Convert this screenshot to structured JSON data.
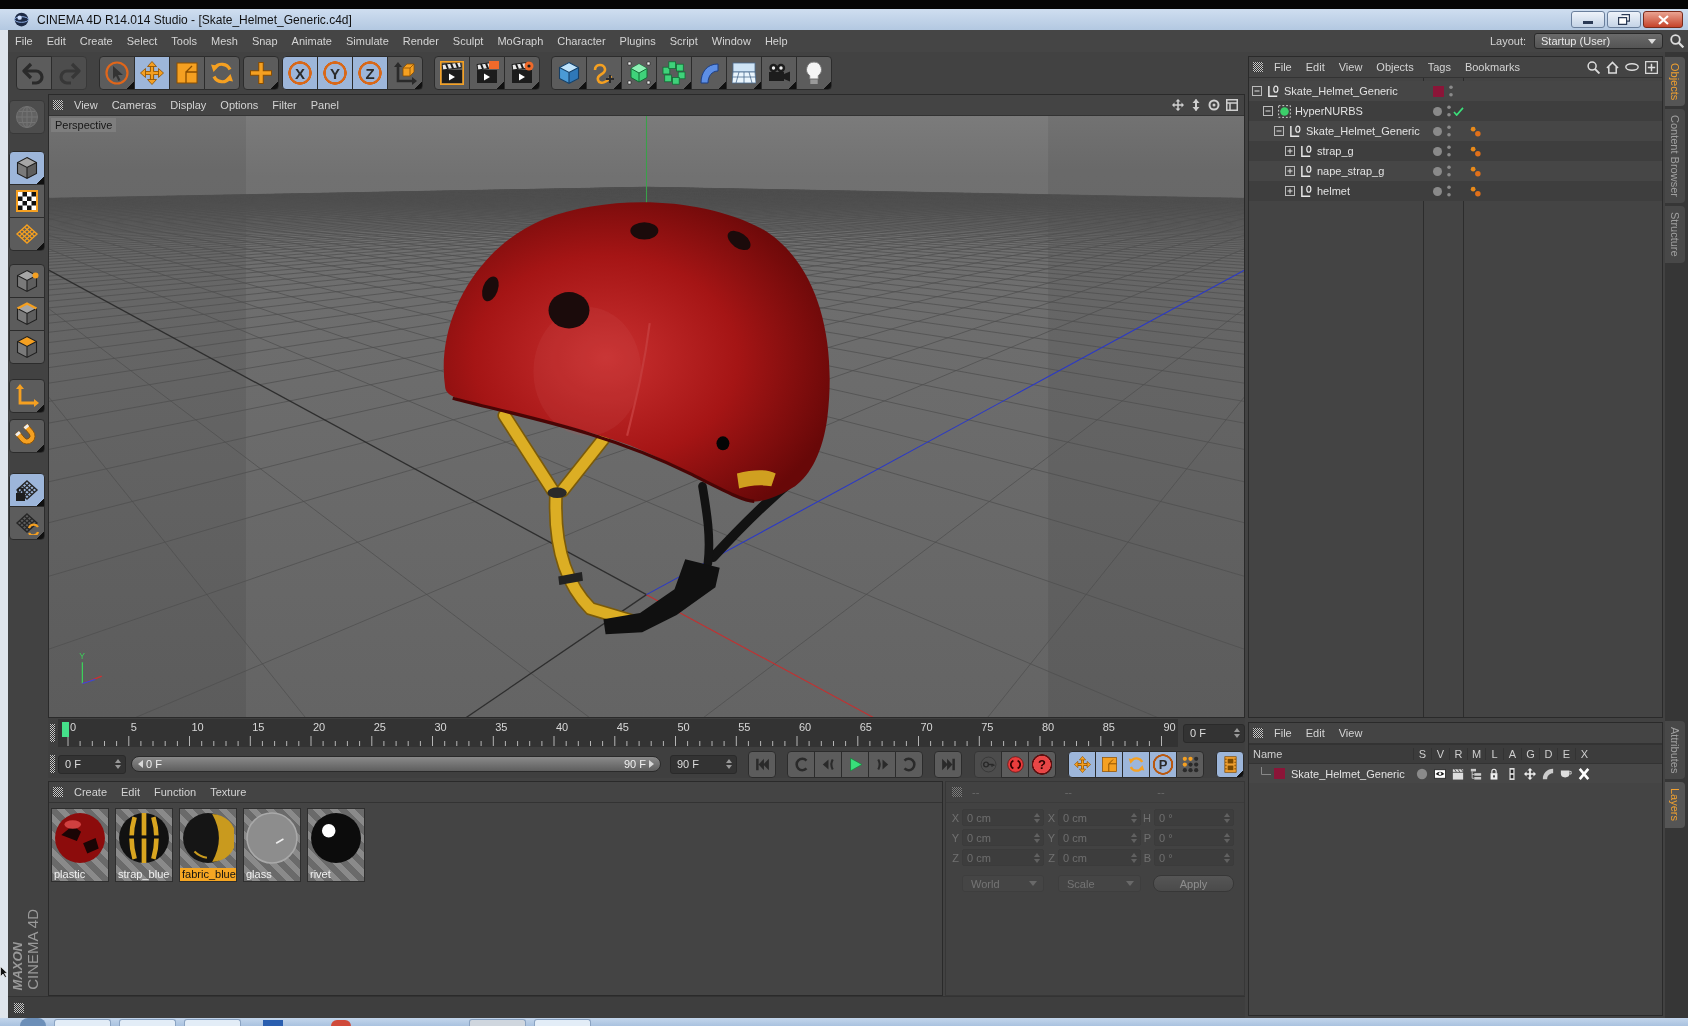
{
  "window": {
    "title": "CINEMA 4D R14.014 Studio - [Skate_Helmet_Generic.c4d]"
  },
  "menu": [
    "File",
    "Edit",
    "Create",
    "Select",
    "Tools",
    "Mesh",
    "Snap",
    "Animate",
    "Simulate",
    "Render",
    "Sculpt",
    "MoGraph",
    "Character",
    "Plugins",
    "Script",
    "Window",
    "Help"
  ],
  "layout": {
    "label": "Layout:",
    "value": "Startup (User)"
  },
  "toolbar": [
    [
      {
        "selected": false,
        "disabled": false
      },
      {
        "selected": false,
        "disabled": true
      }
    ],
    [
      {
        "selected": false
      },
      {
        "selected": true
      },
      {
        "selected": false
      },
      {
        "selected": false
      }
    ],
    [
      {
        "selected": false
      }
    ],
    [
      {
        "label": "X",
        "selected": true
      },
      {
        "label": "Y",
        "selected": true
      },
      {
        "label": "Z",
        "selected": true
      },
      {
        "selected": false
      }
    ],
    [
      {
        "selected": false
      },
      {
        "selected": false
      },
      {
        "selected": false
      }
    ],
    [
      {
        "selected": false
      },
      {
        "selected": false
      },
      {
        "selected": false
      },
      {
        "selected": false
      },
      {
        "selected": false
      },
      {
        "selected": false
      },
      {
        "selected": false
      },
      {
        "selected": false
      }
    ]
  ],
  "side_toolbar": [
    [
      {
        "selected": false,
        "disabled": true
      }
    ],
    [
      {
        "selected": true
      },
      {
        "selected": false
      },
      {
        "selected": false
      }
    ],
    [
      {
        "selected": false
      },
      {
        "selected": false
      },
      {
        "selected": false
      }
    ],
    [
      {
        "selected": false
      }
    ],
    [
      {
        "selected": false
      }
    ],
    [
      {
        "selected": true
      },
      {
        "selected": false
      }
    ]
  ],
  "logo": [
    "MAXON",
    "CINEMA 4D"
  ],
  "viewport": {
    "menu": [
      "View",
      "Cameras",
      "Display",
      "Options",
      "Filter",
      "Panel"
    ],
    "label": "Perspective",
    "axis_label": "Y"
  },
  "timeline": {
    "ticks": [
      "0",
      "5",
      "10",
      "15",
      "20",
      "25",
      "30",
      "35",
      "40",
      "45",
      "50",
      "55",
      "60",
      "65",
      "70",
      "75",
      "80",
      "85",
      "90"
    ],
    "level": 0,
    "frame": "0 F",
    "start": "0 F",
    "range_start": "0 F",
    "range_end": "90 F",
    "end": "90 F",
    "keys": [
      {
        "disabled": true
      },
      {
        "disabled": false
      },
      {
        "label": "?",
        "disabled": false
      }
    ],
    "modes": [
      {
        "selected": true
      },
      {
        "selected": true
      },
      {
        "selected": true
      },
      {
        "label": "P",
        "selected": true
      },
      {
        "selected": false
      }
    ],
    "timeline_button": {
      "selected": true
    }
  },
  "materials": {
    "menu": [
      "Create",
      "Edit",
      "Function",
      "Texture"
    ],
    "items": [
      {
        "name": "plastic",
        "selected": false
      },
      {
        "name": "strap_blue",
        "selected": false
      },
      {
        "name": "fabric_blue",
        "selected": true
      },
      {
        "name": "glass",
        "selected": false
      },
      {
        "name": "rivet",
        "selected": false
      }
    ]
  },
  "coordinates": {
    "disabled": true,
    "headers": [
      "--",
      "--",
      "--"
    ],
    "rows": [
      [
        {
          "axis": "X",
          "value": "0 cm"
        },
        {
          "axis": "X",
          "value": "0 cm"
        },
        {
          "axis": "H",
          "value": "0 °"
        }
      ],
      [
        {
          "axis": "Y",
          "value": "0 cm"
        },
        {
          "axis": "Y",
          "value": "0 cm"
        },
        {
          "axis": "P",
          "value": "0 °"
        }
      ],
      [
        {
          "axis": "Z",
          "value": "0 cm"
        },
        {
          "axis": "Z",
          "value": "0 cm"
        },
        {
          "axis": "B",
          "value": "0 °"
        }
      ]
    ],
    "system": "World",
    "mode": "Scale",
    "apply": "Apply"
  },
  "objects": {
    "menu": [
      "File",
      "Edit",
      "View",
      "Objects",
      "Tags",
      "Bookmarks"
    ],
    "tree": [
      {
        "name": "Skate_Helmet_Generic",
        "kind": "null",
        "expanded": true,
        "color": "#8b1538",
        "tagged": false,
        "children": [
          {
            "name": "HyperNURBS",
            "kind": "generator",
            "expanded": true,
            "enabled": true,
            "tagged": false,
            "children": [
              {
                "name": "Skate_Helmet_Generic",
                "kind": "null",
                "expanded": true,
                "tagged": true,
                "children": [
                  {
                    "name": "strap_g",
                    "kind": "null",
                    "expanded": false,
                    "tagged": true
                  },
                  {
                    "name": "nape_strap_g",
                    "kind": "null",
                    "expanded": false,
                    "tagged": true
                  },
                  {
                    "name": "helmet",
                    "kind": "null",
                    "expanded": false,
                    "tagged": true
                  }
                ]
              }
            ]
          }
        ]
      }
    ]
  },
  "layers": {
    "menu": [
      "File",
      "Edit",
      "View"
    ],
    "columns": [
      "Name",
      "S",
      "V",
      "R",
      "M",
      "L",
      "A",
      "G",
      "D",
      "E",
      "X"
    ],
    "rows": [
      {
        "name": "Skate_Helmet_Generic",
        "color": "#8b1538"
      }
    ]
  },
  "side_tabs": {
    "top": [
      {
        "label": "Objects",
        "selected": true
      },
      {
        "label": "Content Browser",
        "selected": false
      },
      {
        "label": "Structure",
        "selected": false
      }
    ],
    "bottom": [
      {
        "label": "Attributes",
        "selected": false
      },
      {
        "label": "Layers",
        "selected": true
      }
    ]
  }
}
